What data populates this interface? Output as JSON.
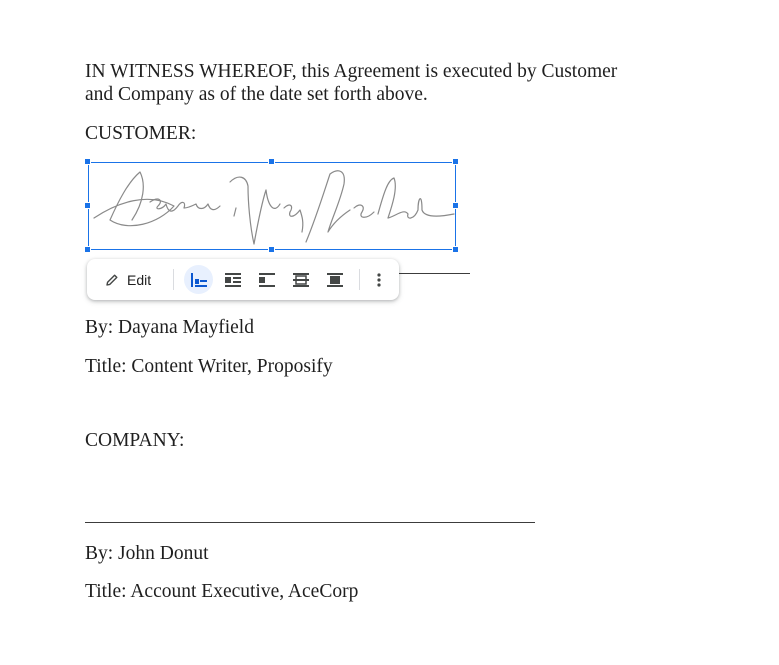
{
  "document": {
    "witness_line1": "IN WITNESS WHEREOF, this Agreement is executed by Customer",
    "witness_line2": "and Company as of the date set forth above.",
    "customer_label": "CUSTOMER:",
    "customer_by": "By: Dayana Mayfield",
    "customer_title": "Title: Content Writer, Proposify",
    "company_label": "COMPANY:",
    "company_by": "By: John Donut",
    "company_title": "Title: Account Executive, AceCorp"
  },
  "image_toolbar": {
    "edit_label": "Edit",
    "edit_icon": "pencil-icon",
    "wrap_options": [
      {
        "icon": "wrap-inline-icon",
        "active": true
      },
      {
        "icon": "wrap-text-icon",
        "active": false
      },
      {
        "icon": "break-text-icon",
        "active": false
      },
      {
        "icon": "behind-text-icon",
        "active": false
      },
      {
        "icon": "in-front-of-text-icon",
        "active": false
      }
    ],
    "more_icon": "more-vert-icon"
  },
  "colors": {
    "selection": "#1a73e8",
    "active_bg": "#e8f0fe",
    "icon": "#444746",
    "active_icon": "#0b57d0",
    "signature_ink": "#8a8a8a"
  }
}
